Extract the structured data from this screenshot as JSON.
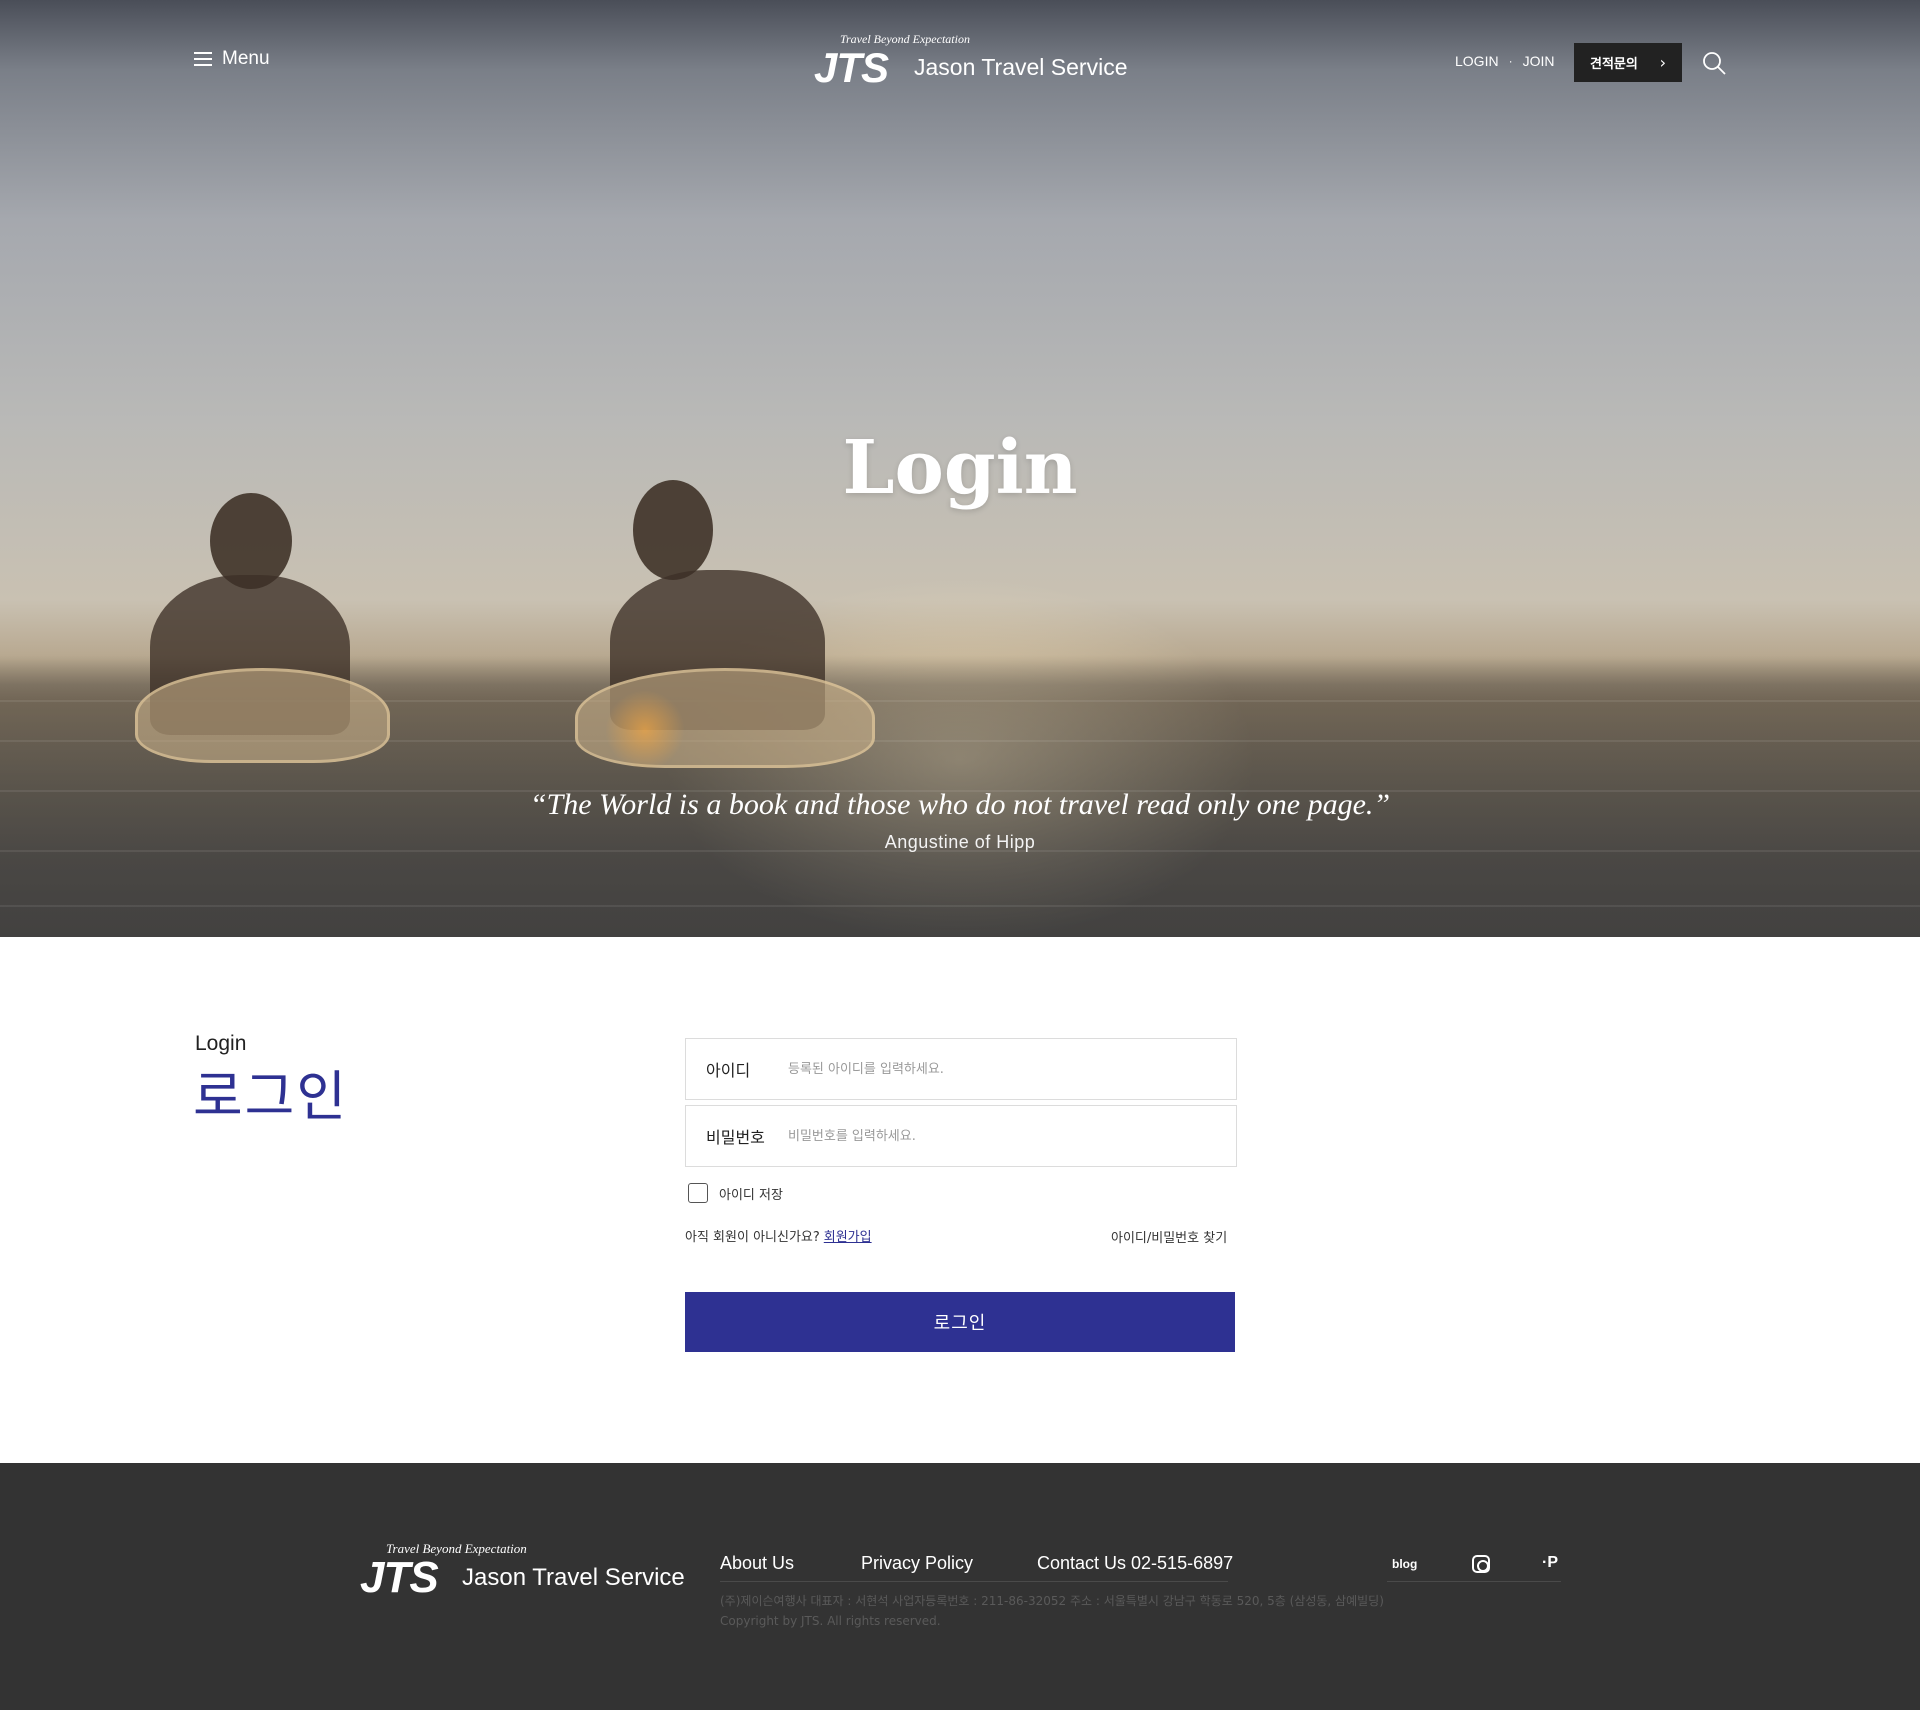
{
  "header": {
    "menu_label": "Menu",
    "logo": {
      "tagline": "Travel Beyond Expectation",
      "mark": "JTS",
      "name": "Jason Travel Service"
    },
    "login_link": "LOGIN",
    "separator": "·",
    "join_link": "JOIN",
    "quote_button": "견적문의",
    "quote_chevron": "›"
  },
  "hero": {
    "title": "Login",
    "quote": "“The World is a book and those who do not travel read only one page.”",
    "author": "Angustine of Hipp"
  },
  "login": {
    "heading_en": "Login",
    "heading_ko": "로그인",
    "id_label": "아이디",
    "id_placeholder": "등록된 아이디를 입력하세요.",
    "pw_label": "비밀번호",
    "pw_placeholder": "비밀번호를 입력하세요.",
    "remember_label": "아이디 저장",
    "not_member_text": "아직 회원이 아니신가요?",
    "signup_link": "회원가입",
    "find_link": "아이디/비밀번호 찾기",
    "submit_label": "로그인"
  },
  "footer": {
    "logo": {
      "tagline": "Travel Beyond Expectation",
      "mark": "JTS",
      "name": "Jason Travel Service"
    },
    "links": {
      "about": "About Us",
      "privacy": "Privacy Policy",
      "contact": "Contact Us 02-515-6897"
    },
    "social": {
      "blog": "blog",
      "post": "·P"
    },
    "company_info": "(주)제이슨여행사 대표자 : 서현석 사업자등록번호 : 211-86-32052 주소 : 서울특별시 강남구 학동로 520, 5층 (삼성동, 삼예빌딩)",
    "copyright": "Copyright by JTS. All rights reserved."
  },
  "colors": {
    "accent": "#2e3192",
    "footer_bg": "#333333",
    "quote_button_bg": "#222222"
  }
}
